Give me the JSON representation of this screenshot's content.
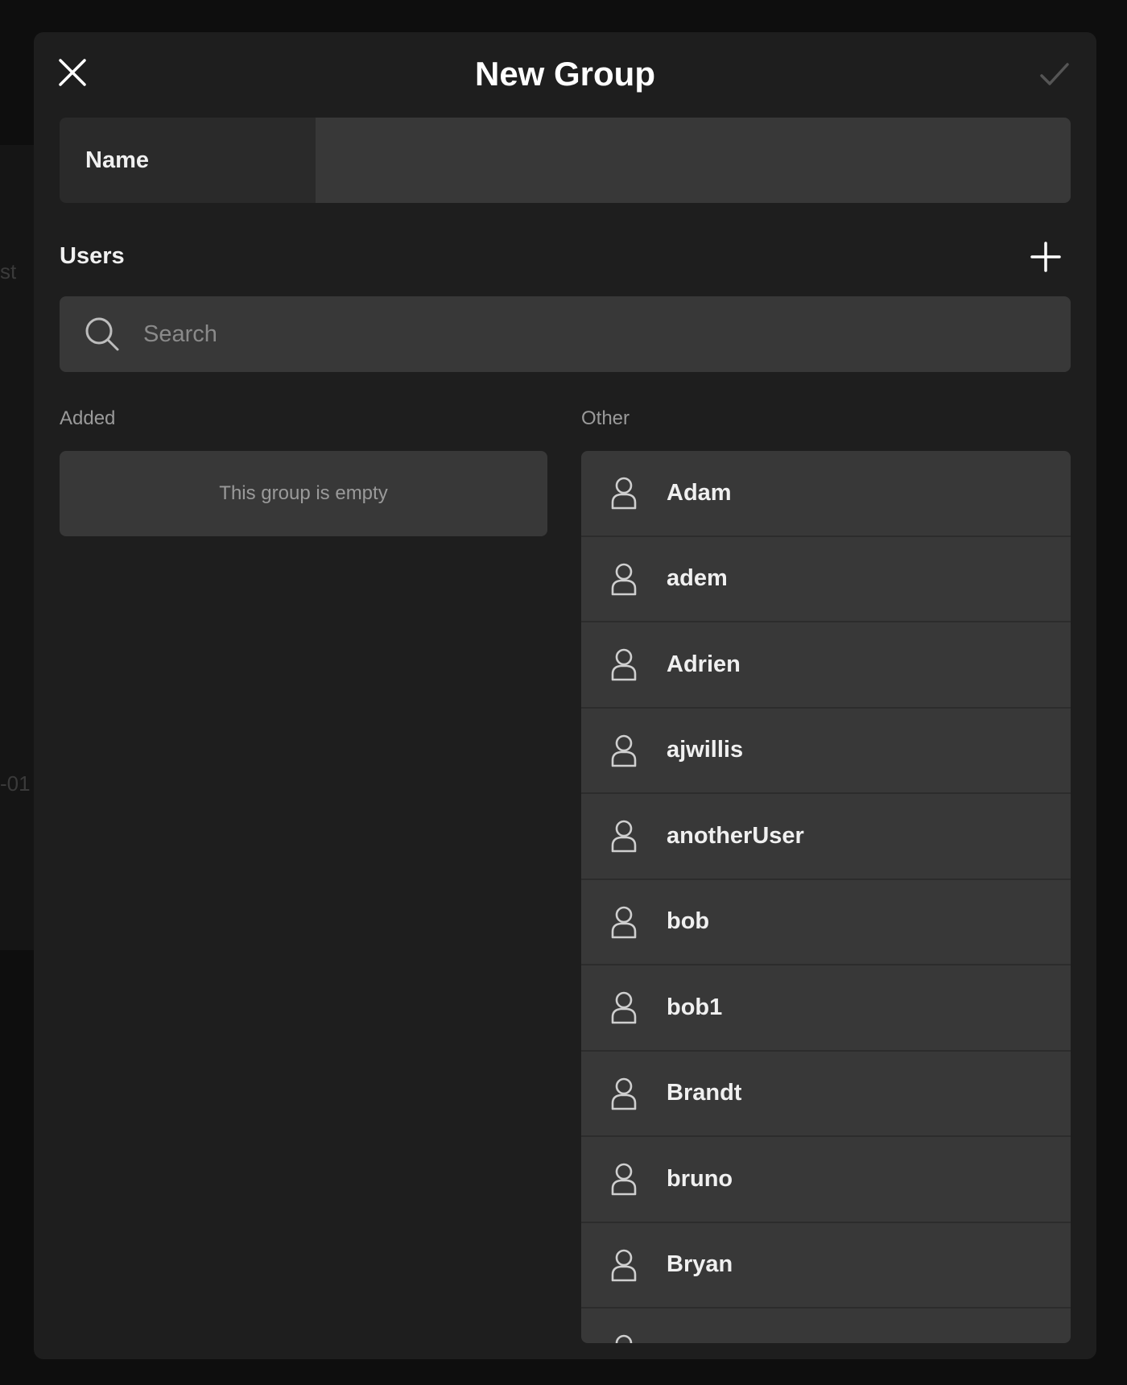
{
  "background": {
    "fragment_top": "st",
    "fragment_mid": "-01"
  },
  "header": {
    "title": "New Group"
  },
  "name_field": {
    "label": "Name",
    "value": "",
    "placeholder": ""
  },
  "users_section": {
    "label": "Users"
  },
  "search": {
    "placeholder": "Search",
    "value": ""
  },
  "added": {
    "label": "Added",
    "empty_text": "This group is empty"
  },
  "other": {
    "label": "Other",
    "users": [
      {
        "name": "Adam"
      },
      {
        "name": "adem"
      },
      {
        "name": "Adrien"
      },
      {
        "name": "ajwillis"
      },
      {
        "name": "anotherUser"
      },
      {
        "name": "bob"
      },
      {
        "name": "bob1"
      },
      {
        "name": "Brandt"
      },
      {
        "name": "bruno"
      },
      {
        "name": "Bryan"
      },
      {
        "name": ""
      }
    ]
  },
  "icons": {
    "close": "close-icon",
    "confirm": "checkmark-icon",
    "add": "plus-icon",
    "search": "search-icon",
    "user": "user-icon"
  },
  "colors": {
    "modal_bg": "#1e1e1e",
    "field_bg": "#383838",
    "label_bg": "#2a2a2a",
    "text_primary": "#f0f0f0",
    "text_muted": "#9a9a9a",
    "confirm_disabled": "#555555"
  }
}
